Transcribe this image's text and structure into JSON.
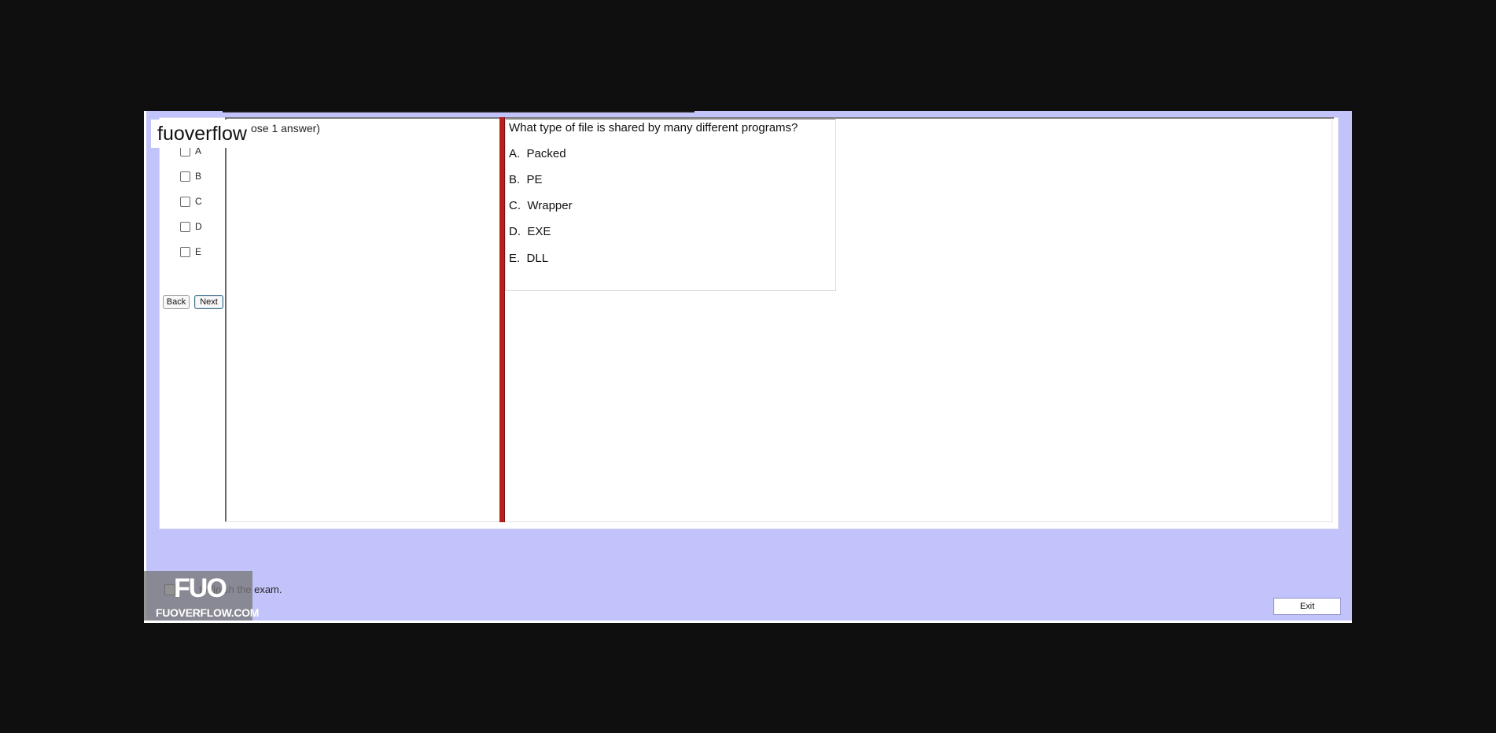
{
  "brand": "fuoverflow",
  "choose_hint": "ose 1 answer)",
  "answers": [
    "A",
    "B",
    "C",
    "D",
    "E"
  ],
  "nav": {
    "back": "Back",
    "next": "Next"
  },
  "question": {
    "text": "What type of file is shared by many different programs?",
    "options": [
      {
        "letter": "A.",
        "text": "Packed"
      },
      {
        "letter": "B.",
        "text": "PE"
      },
      {
        "letter": "C.",
        "text": "Wrapper"
      },
      {
        "letter": "D.",
        "text": "EXE"
      },
      {
        "letter": "E.",
        "text": "DLL"
      }
    ]
  },
  "finish_text": "to finish the exam.",
  "watermark": {
    "logo": "FUO",
    "site": "FUOVERFLOW.COM"
  },
  "exit_label": "Exit",
  "colors": {
    "window_bg": "#c3c3fb",
    "divider_red": "#b8201e",
    "outer_bg": "#0f0f0f"
  }
}
